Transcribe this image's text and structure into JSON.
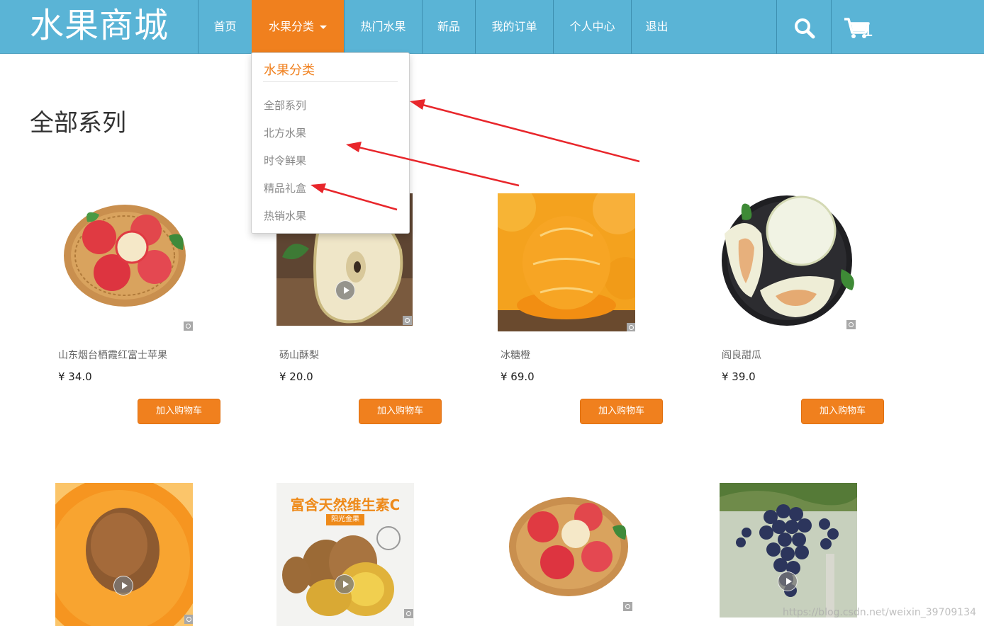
{
  "brand": "水果商城",
  "nav": {
    "items": [
      {
        "label": "首页"
      },
      {
        "label": "水果分类",
        "active": true
      },
      {
        "label": "热门水果"
      },
      {
        "label": "新品"
      },
      {
        "label": "我的订单"
      },
      {
        "label": "个人中心"
      },
      {
        "label": "退出"
      }
    ],
    "cart_count": "1"
  },
  "dropdown": {
    "header": "水果分类",
    "items": [
      "全部系列",
      "北方水果",
      "时令鲜果",
      "精品礼盒",
      "热销水果"
    ]
  },
  "section_title": "全部系列",
  "products": [
    {
      "name": "山东烟台栖霞红富士苹果",
      "price": "¥ 34.0",
      "button": "加入购物车"
    },
    {
      "name": "砀山酥梨",
      "price": "¥ 20.0",
      "button": "加入购物车"
    },
    {
      "name": "冰糖橙",
      "price": "¥ 69.0",
      "button": "加入购物车"
    },
    {
      "name": "阎良甜瓜",
      "price": "¥ 39.0",
      "button": "加入购物车"
    }
  ],
  "products_row2": [
    {
      "promo_text": "富含天然维生素C",
      "promo_badge": "阳光金果"
    }
  ],
  "watermark": "https://blog.csdn.net/weixin_39709134",
  "colors": {
    "navbar": "#5ab4d6",
    "accent": "#f0801e",
    "annotation_arrow": "#e8262b"
  }
}
